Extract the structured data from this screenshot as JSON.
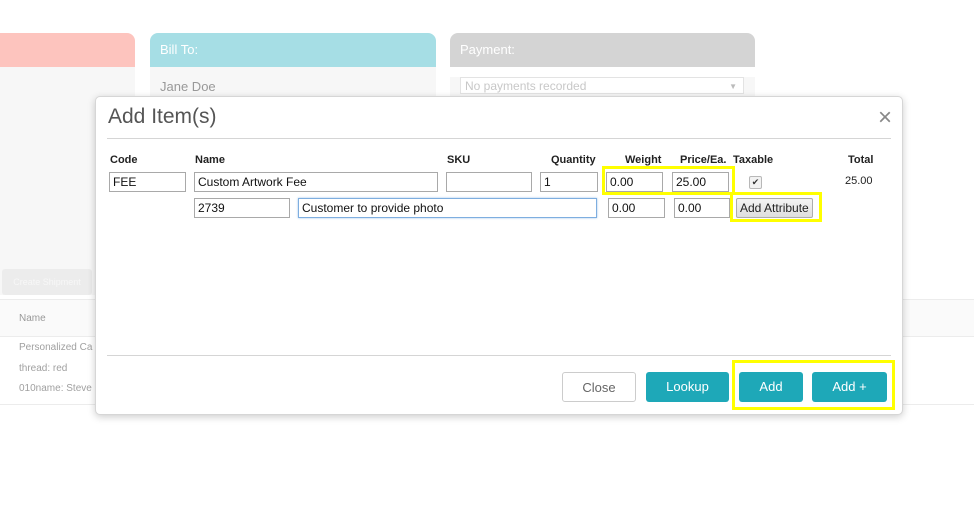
{
  "background": {
    "cards": {
      "left": {
        "title": ""
      },
      "bill_to": {
        "title": "Bill To:",
        "name": "Jane Doe"
      },
      "payment": {
        "title": "Payment:",
        "select_value": "No payments recorded",
        "arrow": "▼"
      }
    },
    "create_shipment_label": "Create Shipment",
    "items_table": {
      "header_name": "Name",
      "rows": [
        "Personalized Ca",
        "thread: red",
        "010name: Steve"
      ]
    },
    "colors": {
      "shipping": "#fdc4be",
      "bill_to": "#a6dee5",
      "payment": "#d4d4d4"
    }
  },
  "modal": {
    "title": "Add Item(s)",
    "close_icon": "×",
    "columns": {
      "code": "Code",
      "name": "Name",
      "sku": "SKU",
      "quantity": "Quantity",
      "weight": "Weight",
      "price": "Price/Ea.",
      "taxable": "Taxable",
      "total": "Total"
    },
    "item": {
      "code": "FEE",
      "name": "Custom Artwork Fee",
      "sku": "",
      "quantity": "1",
      "weight": "0.00",
      "price": "25.00",
      "taxable": true,
      "taxable_glyph": "✔",
      "total": "25.00"
    },
    "attribute": {
      "code": "2739",
      "value": "Customer to provide photo",
      "weight": "0.00",
      "price": "0.00",
      "add_attribute_label": "Add Attribute"
    },
    "buttons": {
      "close": "Close",
      "lookup": "Lookup",
      "add": "Add",
      "add_plus": "Add +"
    },
    "colors": {
      "primary": "#1ea8b8",
      "highlight": "#ffff00"
    }
  }
}
